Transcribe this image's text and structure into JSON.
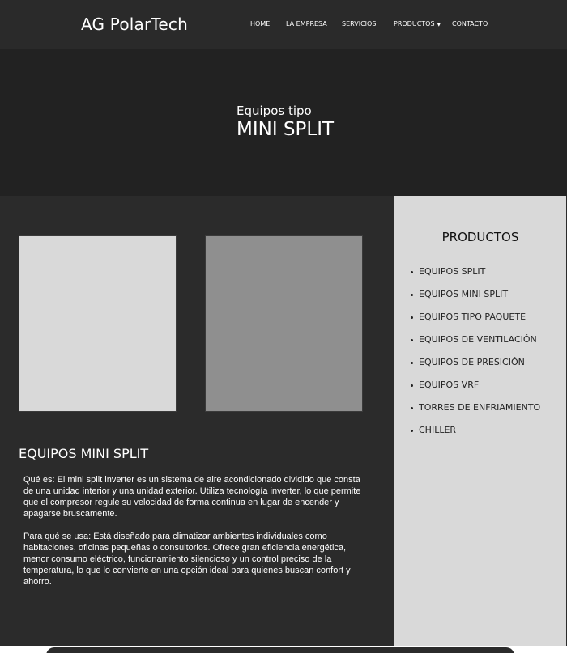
{
  "header": {
    "brand": "AG PolarTech",
    "nav": {
      "home": "HOME",
      "empresa": "LA EMPRESA",
      "servicios": "SERVICIOS",
      "productos": "PRODUCTOS",
      "contacto": "CONTACTO"
    }
  },
  "hero": {
    "subtitle": "Equipos tipo",
    "title": "MINI SPLIT"
  },
  "main": {
    "section_title": "EQUIPOS MINI SPLIT",
    "paragraph_1": "Qué es: El mini split inverter es un sistema de aire acondicionado dividido que consta de una unidad interior y una unidad exterior. Utiliza tecnología inverter, lo que permite que el compresor regule su velocidad de forma continua en lugar de encender y apagarse bruscamente.",
    "paragraph_2": "Para qué se usa: Está diseñado para climatizar ambientes individuales como habitaciones, oficinas pequeñas o consultorios. Ofrece gran eficiencia energética, menor consumo eléctrico, funcionamiento silencioso y un control preciso de la temperatura, lo que lo convierte en una opción ideal para quienes buscan confort y ahorro."
  },
  "sidebar": {
    "title": "PRODUCTOS",
    "items": [
      "EQUIPOS SPLIT",
      "EQUIPOS MINI SPLIT",
      "EQUIPOS TIPO PAQUETE",
      "EQUIPOS DE VENTILACIÓN",
      "EQUIPOS DE PRESICIÓN",
      "EQUIPOS VRF",
      "TORRES DE ENFRIAMIENTO",
      "CHILLER"
    ]
  },
  "colors": {
    "navbar": "#2a2a2a",
    "hero": "#222222",
    "main": "#2b2b2b",
    "sidebar": "#d9d9d9",
    "image_light": "#d9d9d9",
    "image_dark": "#8f8f8f"
  }
}
